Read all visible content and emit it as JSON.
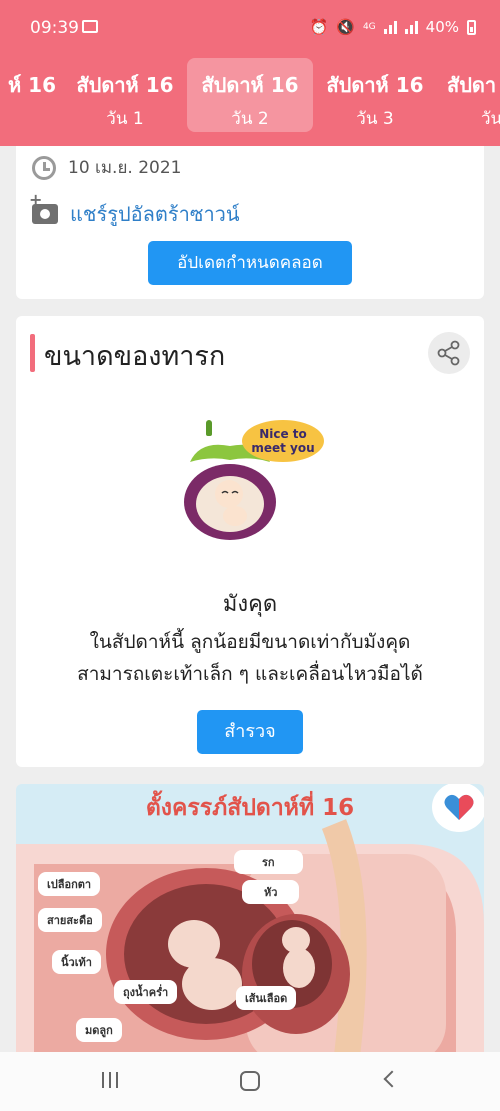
{
  "status_bar": {
    "time": "09:39",
    "network": "4G",
    "battery": "40%"
  },
  "week_tabs": [
    {
      "week": "ห์ 16",
      "day": ""
    },
    {
      "week": "สัปดาห์ 16",
      "day": "วัน 1"
    },
    {
      "week": "สัปดาห์ 16",
      "day": "วัน 2"
    },
    {
      "week": "สัปดาห์ 16",
      "day": "วัน 3"
    },
    {
      "week": "สัปดา",
      "day": "วัน"
    }
  ],
  "due_card": {
    "date": "10 เม.ย. 2021",
    "share_ultrasound": "แชร์รูปอัลตร้าซาวน์",
    "update_button": "อัปเดตกำหนดคลอด"
  },
  "baby_size": {
    "title": "ขนาดของทารก",
    "bubble_text": "Nice to meet you",
    "fruit_name": "มังคุด",
    "description_line1": "ในสัปดาห์นี้ ลูกน้อยมีขนาดเท่ากับมังคุด",
    "description_line2": "สามารถเตะเท้าเล็ก ๆ และเคลื่อนไหวมือได้",
    "explore_button": "สำรวจ"
  },
  "infographic": {
    "title": "ตั้งครรภ์สัปดาห์ที่ 16",
    "labels": {
      "eyelid": "เปลือกตา",
      "cord": "สายสะดือ",
      "toes": "นิ้วเท้า",
      "sac": "ถุงน้ำคร่ำ",
      "uterus": "มดลูก",
      "placenta": "รก",
      "head": "หัว",
      "vessel": "เส้นเลือด"
    }
  },
  "colors": {
    "header": "#f26d7c",
    "primary_button": "#2196f3",
    "link": "#2f7fc8"
  }
}
